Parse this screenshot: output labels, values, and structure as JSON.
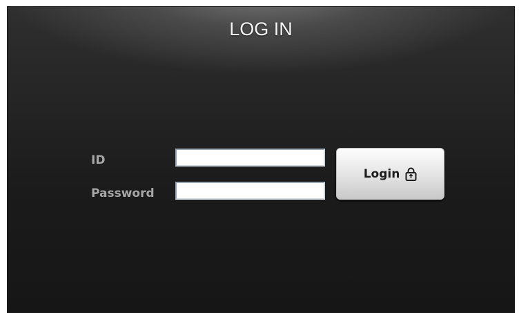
{
  "window": {
    "title": "LOG IN"
  },
  "form": {
    "id_label": "ID",
    "password_label": "Password",
    "id_value": "",
    "password_value": "",
    "login_button_label": "Login",
    "login_icon": "lock-icon"
  },
  "colors": {
    "background": "#1e1e1e",
    "title_text": "#f4f4f4",
    "label_text": "#a7a7a7",
    "button_top": "#fdfdfd",
    "button_bottom": "#c9c9c9"
  }
}
